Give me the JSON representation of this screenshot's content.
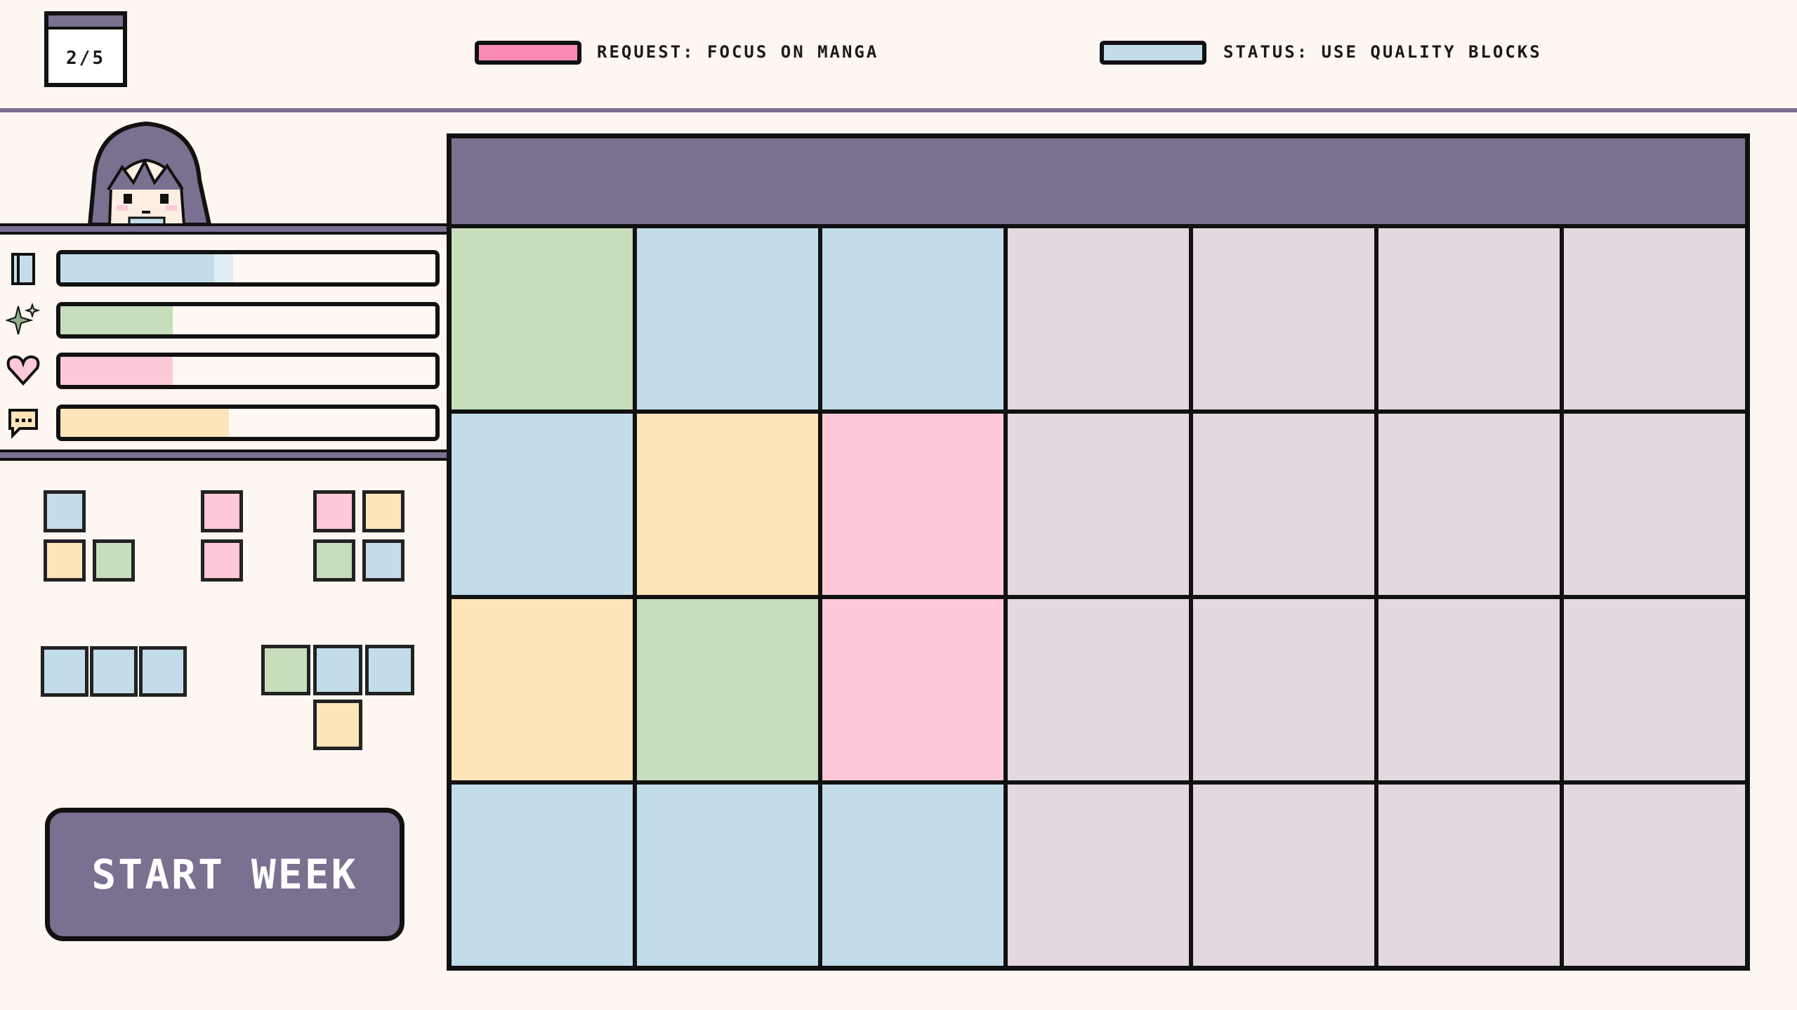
{
  "colors": {
    "blue": "#c2dde9",
    "yellow": "#fde5b9",
    "pink": "#fdc9d8",
    "green": "#c8ddbb",
    "empty": "#e4d8e0",
    "accent": "#7b7090",
    "hot_pink": "#f88bb4"
  },
  "calendar": {
    "label": "2/5",
    "icon": "calendar-icon"
  },
  "request": {
    "label": "REQUEST: FOCUS ON MANGA",
    "color": "#f88bb4"
  },
  "status": {
    "label": "STATUS: USE QUALITY BLOCKS",
    "color": "#c2dde9"
  },
  "stats": [
    {
      "icon": "book-icon",
      "level": 0.41,
      "preview": 0.46,
      "color": "#c2dde9",
      "light": "#dfeef5"
    },
    {
      "icon": "sparkle-icon",
      "level": 0.3,
      "preview": 0.3,
      "color": "#c8ddbb",
      "light": "#e4eedd"
    },
    {
      "icon": "heart-icon",
      "level": 0.3,
      "preview": 0.3,
      "color": "#fdc9d8",
      "light": "#fde1e9"
    },
    {
      "icon": "speech-bubble-icon",
      "level": 0.45,
      "preview": 0.45,
      "color": "#fde5b9",
      "light": "#fef0d9"
    }
  ],
  "pieces": [
    [
      "blue",
      "yellow",
      "green"
    ],
    [
      "pink",
      "pink"
    ],
    [
      "pink",
      "yellow",
      "green",
      "blue"
    ],
    [
      "blue",
      "blue",
      "blue"
    ],
    [
      "green",
      "blue",
      "blue",
      "yellow"
    ]
  ],
  "start_button": {
    "label": "START WEEK"
  },
  "grid": [
    [
      "green",
      "blue",
      "blue",
      "empty",
      "empty",
      "empty",
      "empty"
    ],
    [
      "blue",
      "yellow",
      "pink",
      "empty",
      "empty",
      "empty",
      "empty"
    ],
    [
      "yellow",
      "green",
      "pink",
      "empty",
      "empty",
      "empty",
      "empty"
    ],
    [
      "blue",
      "blue",
      "blue",
      "empty",
      "empty",
      "empty",
      "empty"
    ]
  ]
}
